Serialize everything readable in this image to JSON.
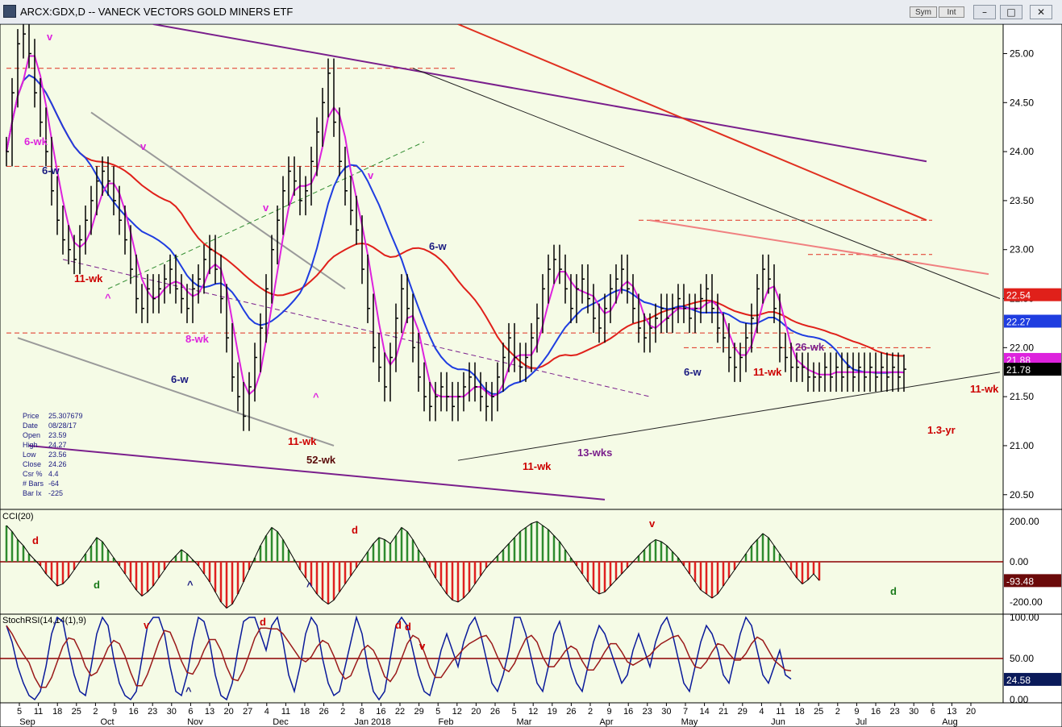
{
  "window": {
    "title": "ARCX:GDX,D -- VANECK VECTORS GOLD MINERS ETF",
    "sym_label": "Sym",
    "int_label": "Int",
    "minimize_label": "–",
    "maximize_label": "□",
    "close_label": "✕"
  },
  "colors": {
    "panel_bg": "#f5fbe6",
    "price_bars": "#000000",
    "ma_short": "#dd22dd",
    "ma_mid": "#1f3de0",
    "ma_long": "#e0201a",
    "trend_purple": "#7a1f8c",
    "trend_red": "#e03020",
    "trend_pink": "#f08080",
    "channel_gray": "#9a9a9a",
    "cci_pos": "#2e8b2e",
    "cci_neg": "#e02020",
    "stoch_k": "#0a1a9a",
    "stoch_d": "#9a1a1a",
    "dotted_line": "#7a1f8c"
  },
  "chart_data": [
    {
      "type": "ohlc",
      "title": "ARCX:GDX,D -- VANECK VECTORS GOLD MINERS ETF",
      "ylim": [
        20.35,
        25.3
      ],
      "y_ticks": [
        "25.00",
        "24.50",
        "24.00",
        "23.50",
        "23.00",
        "22.50",
        "22.00",
        "21.50",
        "21.00",
        "20.50"
      ],
      "x_tick_labels": [
        "5",
        "11",
        "18",
        "25",
        "2",
        "9",
        "16",
        "23",
        "30",
        "6",
        "13",
        "20",
        "27",
        "4",
        "11",
        "18",
        "26",
        "2",
        "8",
        "16",
        "22",
        "29",
        "5",
        "12",
        "20",
        "26",
        "5",
        "12",
        "19",
        "26",
        "2",
        "9",
        "16",
        "23",
        "30",
        "7",
        "14",
        "21",
        "29",
        "4",
        "11",
        "18",
        "25",
        "2",
        "9",
        "16",
        "23",
        "30",
        "6",
        "13",
        "20"
      ],
      "month_labels": [
        "Sep",
        "Oct",
        "Nov",
        "Dec",
        "Jan 2018",
        "Feb",
        "Mar",
        "Apr",
        "May",
        "Jun",
        "Jul",
        "Aug"
      ],
      "series": [
        {
          "name": "price",
          "x": [
            0,
            8,
            16,
            23,
            30,
            37,
            44,
            50,
            57,
            64,
            72,
            79,
            86,
            93,
            100,
            107,
            114,
            121,
            128,
            135,
            142,
            149,
            156,
            163,
            170,
            177,
            184,
            191,
            198,
            205,
            212,
            219,
            226,
            233,
            240,
            247,
            254,
            261,
            268,
            275,
            282,
            289,
            296,
            303,
            310,
            317,
            324,
            331,
            338,
            345,
            352,
            359,
            366,
            373,
            380,
            387,
            394,
            401,
            408,
            415,
            422,
            429,
            436,
            443,
            450,
            457,
            464,
            471,
            478,
            485,
            492,
            499,
            506,
            513,
            520,
            527,
            534,
            541,
            548,
            555,
            562,
            569,
            576,
            583,
            590,
            597,
            604,
            611,
            618,
            625,
            632,
            639,
            646,
            653,
            660,
            667,
            674,
            681,
            688,
            695,
            702,
            709,
            716,
            723,
            730,
            737,
            744,
            751,
            758,
            765,
            772,
            779,
            786,
            793,
            800,
            807,
            814,
            821,
            828,
            835,
            842,
            849,
            856,
            863,
            870,
            877,
            884,
            891,
            898,
            905,
            912,
            919,
            926,
            933,
            940,
            947,
            954,
            961,
            968,
            975,
            982,
            989,
            996,
            1003,
            1010,
            1017,
            1024,
            1031,
            1038,
            1045,
            1052,
            1059,
            1066,
            1073,
            1080,
            1087,
            1094,
            1101,
            1108,
            1115,
            1122,
            1129
          ],
          "close": [
            24.0,
            24.6,
            25.1,
            25.2,
            25.0,
            24.6,
            24.3,
            24.0,
            23.6,
            23.3,
            23.1,
            23.0,
            22.9,
            23.1,
            23.3,
            23.5,
            23.7,
            23.8,
            23.7,
            23.5,
            23.3,
            23.1,
            22.8,
            22.5,
            22.4,
            22.6,
            22.5,
            22.6,
            22.7,
            22.8,
            22.6,
            22.5,
            22.4,
            22.6,
            22.7,
            22.9,
            23.0,
            22.8,
            22.5,
            22.1,
            21.7,
            21.5,
            21.3,
            21.6,
            21.9,
            22.2,
            22.6,
            23.0,
            23.3,
            23.6,
            23.8,
            23.7,
            23.5,
            23.6,
            23.9,
            24.2,
            24.5,
            24.8,
            24.3,
            23.9,
            23.6,
            23.4,
            23.2,
            22.8,
            22.4,
            22.0,
            21.8,
            21.6,
            21.9,
            22.3,
            22.6,
            22.4,
            22.0,
            21.7,
            21.5,
            21.4,
            21.5,
            21.6,
            21.5,
            21.4,
            21.5,
            21.6,
            21.7,
            21.6,
            21.5,
            21.4,
            21.5,
            21.7,
            21.9,
            22.1,
            21.9,
            21.8,
            21.9,
            22.1,
            22.3,
            22.6,
            22.8,
            22.9,
            22.8,
            22.6,
            22.4,
            22.6,
            22.7,
            22.5,
            22.3,
            22.2,
            22.4,
            22.6,
            22.7,
            22.8,
            22.6,
            22.4,
            22.2,
            22.1,
            22.2,
            22.3,
            22.4,
            22.3,
            22.4,
            22.5,
            22.4,
            22.3,
            22.4,
            22.5,
            22.6,
            22.4,
            22.2,
            22.1,
            21.9,
            21.8,
            21.9,
            22.1,
            22.3,
            22.6,
            22.8,
            22.7,
            22.4,
            22.0,
            21.9,
            21.8,
            21.8,
            21.8,
            21.7,
            21.7,
            21.7,
            21.8,
            21.7,
            21.8,
            21.7,
            21.8,
            21.7,
            21.8,
            21.7,
            21.8,
            21.7,
            21.8,
            21.7,
            21.8,
            21.7,
            21.78
          ]
        }
      ],
      "price_labels": {
        "ma_long": "22.54",
        "ma_mid": "22.27",
        "ma_short": "21.88",
        "last": "21.78"
      },
      "annotations": [
        {
          "text": "v",
          "color": "#dd22dd"
        },
        {
          "text": "v",
          "color": "#dd22dd"
        },
        {
          "text": "v",
          "color": "#dd22dd"
        },
        {
          "text": "v",
          "color": "#dd22dd"
        },
        {
          "text": "6-wk",
          "color": "#dd22dd"
        },
        {
          "text": "6-w",
          "color": "#1a1a80"
        },
        {
          "text": "11-wk",
          "color": "#cc0000"
        },
        {
          "text": "^",
          "color": "#dd22dd"
        },
        {
          "text": "8-wk",
          "color": "#dd22dd"
        },
        {
          "text": "6-w",
          "color": "#1a1a80"
        },
        {
          "text": "11-wk",
          "color": "#cc0000"
        },
        {
          "text": "52-wk",
          "color": "#5a0a0a"
        },
        {
          "text": "^",
          "color": "#dd22dd"
        },
        {
          "text": "6-w",
          "color": "#1a1a80"
        },
        {
          "text": "11-wk",
          "color": "#cc0000"
        },
        {
          "text": "13-wks",
          "color": "#7a1f8c"
        },
        {
          "text": "6-w",
          "color": "#1a1a80"
        },
        {
          "text": "11-wk",
          "color": "#cc0000"
        },
        {
          "text": "26-wk",
          "color": "#7a1f8c"
        },
        {
          "text": "11-wk",
          "color": "#cc0000"
        },
        {
          "text": "1.3-yr",
          "color": "#cc0000"
        }
      ]
    },
    {
      "type": "bar",
      "name": "CCI(20)",
      "ylim": [
        -260,
        260
      ],
      "y_ticks": [
        "200.00",
        "0.00",
        "-200.00"
      ],
      "last_value": "-93.48",
      "annotations": [
        "d",
        "d",
        "d",
        "^",
        "^",
        "v",
        "d"
      ],
      "values": [
        180,
        150,
        110,
        80,
        40,
        10,
        -20,
        -60,
        -90,
        -120,
        -110,
        -80,
        -40,
        0,
        40,
        80,
        120,
        100,
        60,
        20,
        -20,
        -60,
        -100,
        -140,
        -170,
        -150,
        -120,
        -80,
        -40,
        0,
        30,
        60,
        40,
        10,
        -20,
        -60,
        -100,
        -150,
        -200,
        -230,
        -210,
        -160,
        -100,
        -40,
        20,
        80,
        130,
        170,
        150,
        110,
        60,
        10,
        -40,
        -80,
        -120,
        -160,
        -190,
        -210,
        -190,
        -150,
        -110,
        -70,
        -30,
        10,
        50,
        90,
        120,
        110,
        90,
        130,
        170,
        150,
        110,
        60,
        20,
        -30,
        -80,
        -120,
        -160,
        -190,
        -200,
        -180,
        -150,
        -110,
        -70,
        -30,
        0,
        30,
        60,
        90,
        120,
        150,
        170,
        190,
        200,
        180,
        160,
        130,
        100,
        60,
        20,
        -20,
        -60,
        -100,
        -140,
        -160,
        -150,
        -120,
        -90,
        -60,
        -30,
        0,
        30,
        60,
        90,
        110,
        100,
        80,
        50,
        20,
        -20,
        -60,
        -100,
        -140,
        -160,
        -180,
        -160,
        -120,
        -80,
        -40,
        0,
        40,
        80,
        110,
        140,
        120,
        80,
        40,
        0,
        -40,
        -80,
        -110,
        -90,
        -60,
        -93
      ]
    },
    {
      "type": "line",
      "name": "StochRSI(14,14(1),9)",
      "ylim": [
        0,
        100
      ],
      "y_ticks": [
        "100.00",
        "50.00",
        "0.00"
      ],
      "last_value": "24.58",
      "annotations": [
        "v",
        "d",
        "^",
        "d",
        "v",
        "d",
        "v"
      ],
      "k": [
        90,
        70,
        40,
        20,
        5,
        0,
        10,
        40,
        80,
        100,
        95,
        60,
        30,
        10,
        5,
        40,
        80,
        100,
        90,
        50,
        20,
        5,
        0,
        10,
        50,
        90,
        100,
        100,
        80,
        40,
        10,
        5,
        30,
        70,
        100,
        95,
        70,
        30,
        5,
        0,
        20,
        60,
        95,
        100,
        100,
        80,
        60,
        90,
        100,
        70,
        30,
        10,
        40,
        80,
        100,
        90,
        50,
        20,
        5,
        10,
        40,
        70,
        100,
        80,
        40,
        10,
        0,
        10,
        50,
        90,
        100,
        90,
        60,
        30,
        10,
        5,
        30,
        60,
        80,
        60,
        40,
        70,
        90,
        100,
        80,
        50,
        20,
        10,
        30,
        60,
        100,
        100,
        80,
        50,
        20,
        10,
        40,
        80,
        95,
        70,
        40,
        20,
        10,
        40,
        70,
        90,
        80,
        60,
        40,
        20,
        30,
        60,
        80,
        60,
        40,
        70,
        90,
        100,
        80,
        50,
        20,
        10,
        40,
        70,
        90,
        80,
        60,
        30,
        20,
        50,
        80,
        100,
        90,
        60,
        30,
        20,
        40,
        60,
        30,
        25
      ]
    }
  ]
}
